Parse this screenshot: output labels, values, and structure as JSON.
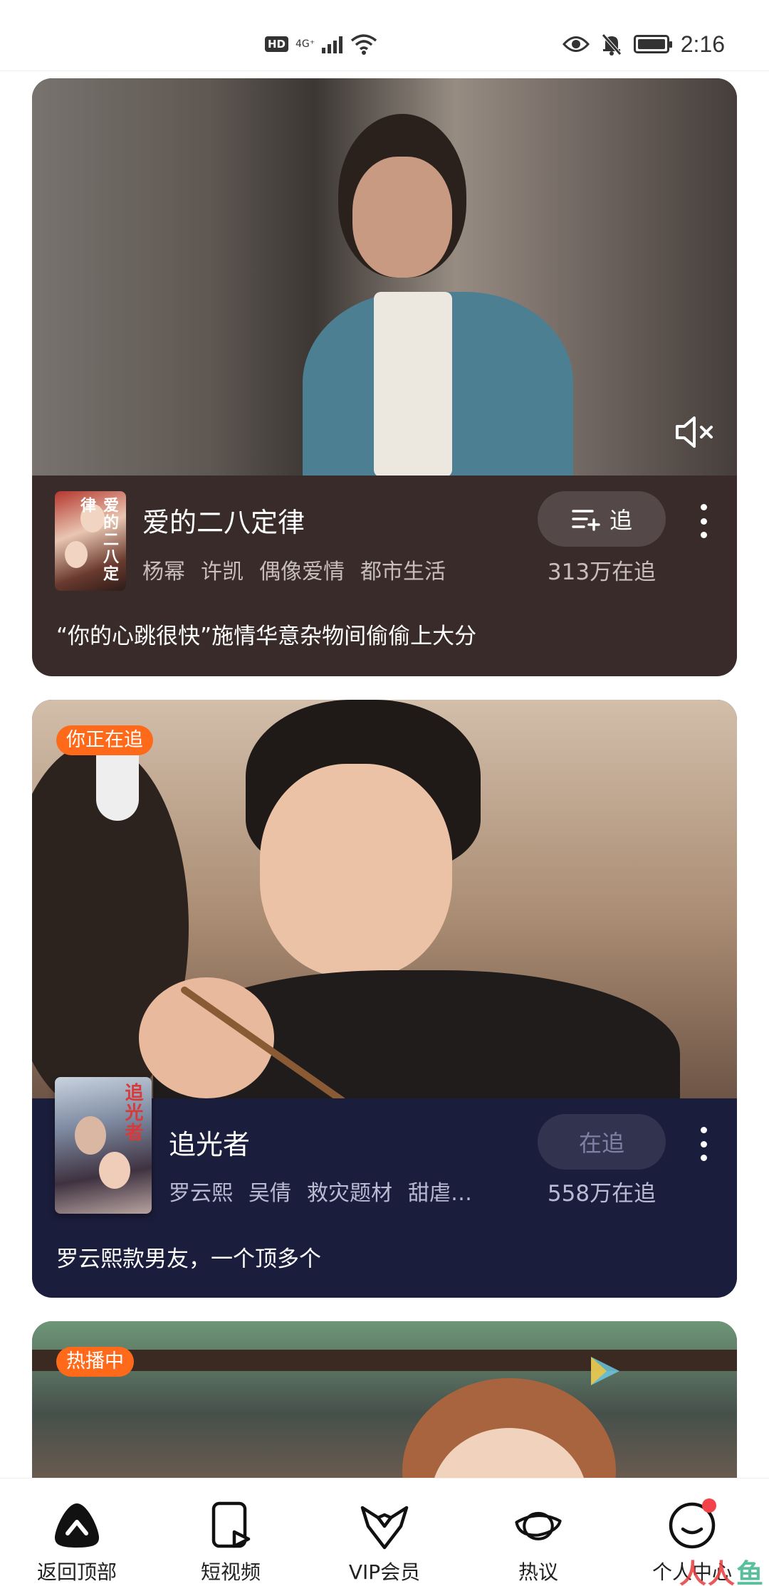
{
  "status_bar": {
    "hd": "HD",
    "network": "4G⁺",
    "wifi_label": "6",
    "time": "2:16"
  },
  "feed": [
    {
      "badge": "",
      "title": "爱的二八定律",
      "poster_title": "爱的二八定律",
      "tags": [
        "杨幂",
        "许凯",
        "偶像爱情",
        "都市生活"
      ],
      "follow_label": "追",
      "follow_count": "313万在追",
      "tagline": "“你的心跳很快”施情华意杂物间偷偷上大分",
      "muted": true
    },
    {
      "badge": "你正在追",
      "title": "追光者",
      "poster_title": "追光者",
      "tags": [
        "罗云熙",
        "吴倩",
        "救灾题材",
        "甜虐…"
      ],
      "follow_label": "在追",
      "follow_count": "558万在追",
      "tagline": "罗云熙款男友，一个顶多个"
    },
    {
      "badge": "热播中"
    }
  ],
  "bottom_nav": [
    {
      "label": "返回顶部",
      "icon": "back-to-top-icon"
    },
    {
      "label": "短视频",
      "icon": "short-video-icon"
    },
    {
      "label": "VIP会员",
      "icon": "vip-bowtie-icon"
    },
    {
      "label": "热议",
      "icon": "discussion-planet-icon"
    },
    {
      "label": "个人中心",
      "icon": "profile-smile-icon",
      "has_dot": true
    }
  ],
  "watermark": {
    "part1": "人人",
    "part2": "鱼"
  },
  "colors": {
    "card1_bg": "#3a2b2b",
    "card2_bg": "#1b1d3c",
    "badge_orange": "#ff6a1a",
    "notification_red": "#f4424b"
  }
}
